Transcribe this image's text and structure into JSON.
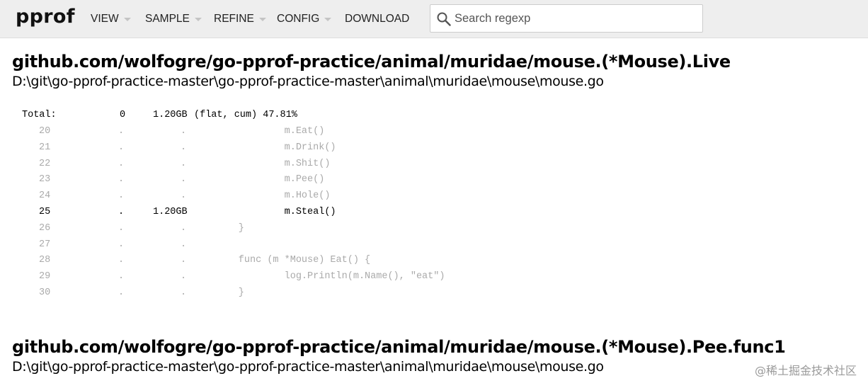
{
  "header": {
    "logo": "pprof",
    "menu": [
      {
        "label": "VIEW",
        "dropdown": true
      },
      {
        "label": "SAMPLE",
        "dropdown": true
      },
      {
        "label": "REFINE",
        "dropdown": true
      },
      {
        "label": "CONFIG",
        "dropdown": true
      },
      {
        "label": "DOWNLOAD",
        "dropdown": false
      }
    ],
    "search": {
      "placeholder": "Search regexp",
      "value": ""
    }
  },
  "sections": [
    {
      "function": "github.com/wolfogre/go-pprof-practice/animal/muridae/mouse.(*Mouse).Live",
      "file": "D:\\git\\go-pprof-practice-master\\go-pprof-practice-master\\animal\\muridae\\mouse\\mouse.go",
      "total": {
        "label": "Total:",
        "flat": "0",
        "cum": "1.20GB",
        "note": "(flat, cum) 47.81%"
      },
      "lines": [
        {
          "num": "20",
          "flat": ".",
          "cum": ".",
          "code": "                m.Eat()",
          "hot": false
        },
        {
          "num": "21",
          "flat": ".",
          "cum": ".",
          "code": "                m.Drink()",
          "hot": false
        },
        {
          "num": "22",
          "flat": ".",
          "cum": ".",
          "code": "                m.Shit()",
          "hot": false
        },
        {
          "num": "23",
          "flat": ".",
          "cum": ".",
          "code": "                m.Pee()",
          "hot": false
        },
        {
          "num": "24",
          "flat": ".",
          "cum": ".",
          "code": "                m.Hole()",
          "hot": false
        },
        {
          "num": "25",
          "flat": ".",
          "cum": "1.20GB",
          "code": "                m.Steal()",
          "hot": true
        },
        {
          "num": "26",
          "flat": ".",
          "cum": ".",
          "code": "        }",
          "hot": false
        },
        {
          "num": "27",
          "flat": ".",
          "cum": ".",
          "code": "",
          "hot": false
        },
        {
          "num": "28",
          "flat": ".",
          "cum": ".",
          "code": "        func (m *Mouse) Eat() {",
          "hot": false
        },
        {
          "num": "29",
          "flat": ".",
          "cum": ".",
          "code": "                log.Println(m.Name(), \"eat\")",
          "hot": false
        },
        {
          "num": "30",
          "flat": ".",
          "cum": ".",
          "code": "        }",
          "hot": false
        }
      ]
    },
    {
      "function": "github.com/wolfogre/go-pprof-practice/animal/muridae/mouse.(*Mouse).Pee.func1",
      "file": "D:\\git\\go-pprof-practice-master\\go-pprof-practice-master\\animal\\muridae\\mouse\\mouse.go"
    }
  ],
  "watermark": "@稀土掘金技术社区"
}
